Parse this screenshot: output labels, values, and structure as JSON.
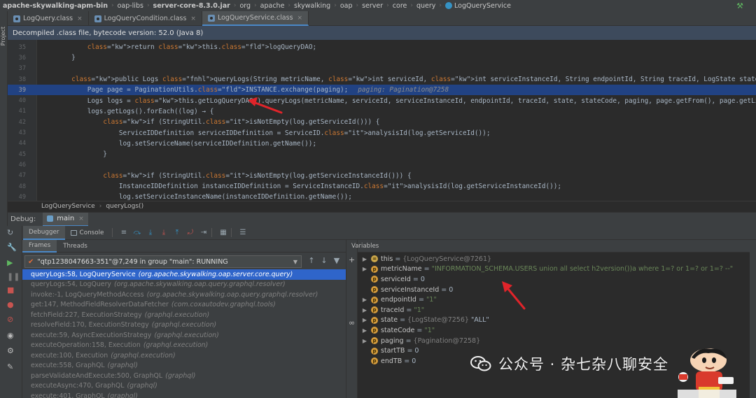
{
  "breadcrumb": {
    "items": [
      "apache-skywalking-apm-bin",
      "oap-libs",
      "server-core-8.3.0.jar",
      "org",
      "apache",
      "skywalking",
      "oap",
      "server",
      "core",
      "query",
      "LogQueryService"
    ]
  },
  "sidebar": {
    "label": "Project"
  },
  "tabs": [
    {
      "label": "LogQuery.class",
      "active": false
    },
    {
      "label": "LogQueryCondition.class",
      "active": false
    },
    {
      "label": "LogQueryService.class",
      "active": true
    }
  ],
  "banner": {
    "text": "Decompiled .class file, bytecode version: 52.0 (Java 8)"
  },
  "editor": {
    "lines": [
      {
        "num": "35",
        "text": "            return this.logQueryDAO;"
      },
      {
        "num": "36",
        "text": "        }"
      },
      {
        "num": "37",
        "text": ""
      },
      {
        "num": "38",
        "text": "        public Logs queryLogs(String metricName, int serviceId, int serviceInstanceId, String endpointId, String traceId, LogState state, String stateCode, Pagination paging, long s"
      },
      {
        "num": "39",
        "text": "            Page page = PaginationUtils.INSTANCE.exchange(paging);",
        "inline": "paging: Pagination@7258"
      },
      {
        "num": "40",
        "text": "            Logs logs = this.getLogQueryDAO().queryLogs(metricName, serviceId, serviceInstanceId, endpointId, traceId, state, stateCode, paging, page.getFrom(), page.getLimit(), sta"
      },
      {
        "num": "41",
        "text": "            logs.getLogs().forEach((log) → {"
      },
      {
        "num": "42",
        "text": "                if (StringUtil.isNotEmpty(log.getServiceId())) {"
      },
      {
        "num": "43",
        "text": "                    ServiceIDDefinition serviceIDDefinition = ServiceID.analysisId(log.getServiceId());"
      },
      {
        "num": "44",
        "text": "                    log.setServiceName(serviceIDDefinition.getName());"
      },
      {
        "num": "45",
        "text": "                }"
      },
      {
        "num": "46",
        "text": ""
      },
      {
        "num": "47",
        "text": "                if (StringUtil.isNotEmpty(log.getServiceInstanceId())) {"
      },
      {
        "num": "48",
        "text": "                    InstanceIDDefinition instanceIDDefinition = ServiceInstanceID.analysisId(log.getServiceInstanceId());"
      },
      {
        "num": "49",
        "text": "                    log.setServiceInstanceName(instanceIDDefinition.getName());"
      }
    ]
  },
  "editor_crumbs": {
    "class_name": "LogQueryService",
    "method": "queryLogs()"
  },
  "debug": {
    "label": "Debug:",
    "session_tab": "main",
    "debugger_tab": "Debugger",
    "console_tab": "Console",
    "frames_tab": "Frames",
    "threads_tab": "Threads",
    "variables_title": "Variables",
    "thread": "\"qtp1238047663-351\"@7,249 in group \"main\": RUNNING",
    "frames": [
      {
        "method": "queryLogs:58, LogQueryService",
        "pkg": "(org.apache.skywalking.oap.server.core.query)",
        "selected": true
      },
      {
        "method": "queryLogs:54, LogQuery",
        "pkg": "(org.apache.skywalking.oap.query.graphql.resolver)",
        "selected": false
      },
      {
        "method": "invoke:-1, LogQueryMethodAccess",
        "pkg": "(org.apache.skywalking.oap.query.graphql.resolver)",
        "selected": false
      },
      {
        "method": "get:147, MethodFieldResolverDataFetcher",
        "pkg": "(com.coxautodev.graphql.tools)",
        "selected": false
      },
      {
        "method": "fetchField:227, ExecutionStrategy",
        "pkg": "(graphql.execution)",
        "selected": false
      },
      {
        "method": "resolveField:170, ExecutionStrategy",
        "pkg": "(graphql.execution)",
        "selected": false
      },
      {
        "method": "execute:59, AsyncExecutionStrategy",
        "pkg": "(graphql.execution)",
        "selected": false
      },
      {
        "method": "executeOperation:158, Execution",
        "pkg": "(graphql.execution)",
        "selected": false
      },
      {
        "method": "execute:100, Execution",
        "pkg": "(graphql.execution)",
        "selected": false
      },
      {
        "method": "execute:558, GraphQL",
        "pkg": "(graphql)",
        "selected": false
      },
      {
        "method": "parseValidateAndExecute:500, GraphQL",
        "pkg": "(graphql)",
        "selected": false
      },
      {
        "method": "executeAsync:470, GraphQL",
        "pkg": "(graphql)",
        "selected": false
      },
      {
        "method": "execute:401, GraphQL",
        "pkg": "(graphql)",
        "selected": false
      }
    ],
    "variables": [
      {
        "expandable": true,
        "icon": "=",
        "name": "this",
        "value": "{LogQueryService@7261}",
        "kind": "ref",
        "extra": ""
      },
      {
        "expandable": true,
        "icon": "p",
        "name": "metricName",
        "value": "\"INFORMATION_SCHEMA.USERS union all select h2version())a where 1=? or 1=? or 1=? --\"",
        "kind": "str",
        "extra": ""
      },
      {
        "expandable": false,
        "icon": "p",
        "name": "serviceId",
        "value": "0",
        "kind": "num",
        "extra": ""
      },
      {
        "expandable": false,
        "icon": "p",
        "name": "serviceInstanceId",
        "value": "0",
        "kind": "num",
        "extra": ""
      },
      {
        "expandable": true,
        "icon": "p",
        "name": "endpointId",
        "value": "\"1\"",
        "kind": "str",
        "extra": ""
      },
      {
        "expandable": true,
        "icon": "p",
        "name": "traceId",
        "value": "\"1\"",
        "kind": "str",
        "extra": ""
      },
      {
        "expandable": true,
        "icon": "p",
        "name": "state",
        "value": "{LogState@7256}",
        "kind": "ref",
        "extra": "\"ALL\""
      },
      {
        "expandable": true,
        "icon": "p",
        "name": "stateCode",
        "value": "\"1\"",
        "kind": "str",
        "extra": ""
      },
      {
        "expandable": true,
        "icon": "p",
        "name": "paging",
        "value": "{Pagination@7258}",
        "kind": "ref",
        "extra": ""
      },
      {
        "expandable": false,
        "icon": "p",
        "name": "startTB",
        "value": "0",
        "kind": "num",
        "extra": ""
      },
      {
        "expandable": false,
        "icon": "p",
        "name": "endTB",
        "value": "0",
        "kind": "num",
        "extra": ""
      }
    ]
  },
  "watermark": {
    "text": "公众号 · 杂七杂八聊安全"
  },
  "colors": {
    "accent": "#4a88c7",
    "selection": "#2f65ca",
    "annotation_arrow": "#e0242a",
    "string": "#6a8759",
    "keyword": "#cc7832"
  },
  "icons": [
    "hammer-icon",
    "class-file-icon",
    "bug-icon",
    "resume-icon",
    "stop-icon",
    "step-over-icon",
    "step-into-icon",
    "step-out-icon",
    "filter-icon",
    "wechat-icon"
  ]
}
